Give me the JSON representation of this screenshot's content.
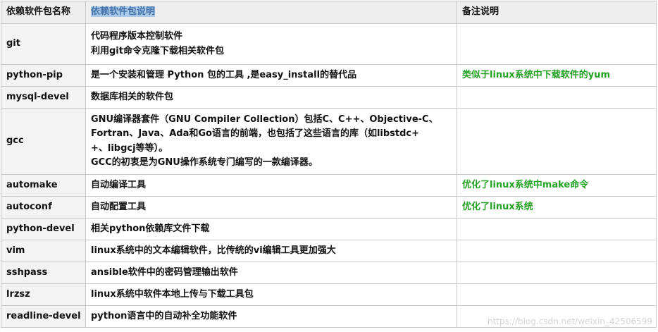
{
  "table": {
    "headers": [
      "依赖软件包名称",
      "依赖软件包说明",
      "备注说明"
    ],
    "rows": [
      {
        "name": "git",
        "desc": [
          "代码程序版本控制软件",
          "利用git命令克隆下载相关软件包"
        ],
        "note": ""
      },
      {
        "name": "python-pip",
        "desc": [
          "是一个安装和管理 Python 包的工具 ,是easy_install的替代品"
        ],
        "note": "类似于linux系统中下载软件的yum"
      },
      {
        "name": "mysql-devel",
        "desc": [
          "数据库相关的软件包"
        ],
        "note": ""
      },
      {
        "name": "gcc",
        "desc": [
          "GNU编译器套件（GNU Compiler Collection）包括C、C++、Objective-C、",
          "Fortran、Java、Ada和Go语言的前端，也包括了这些语言的库（如libstdc+",
          "+、libgcj等等）。",
          "GCC的初衷是为GNU操作系统专门编写的一款编译器。"
        ],
        "note": ""
      },
      {
        "name": "automake",
        "desc": [
          "自动编译工具"
        ],
        "note": "优化了linux系统中make命令"
      },
      {
        "name": "autoconf",
        "desc": [
          "自动配置工具"
        ],
        "note": "优化了linux系统"
      },
      {
        "name": "python-devel",
        "desc": [
          "相关python依赖库文件下载"
        ],
        "note": ""
      },
      {
        "name": "vim",
        "desc": [
          "linux系统中的文本编辑软件，比传统的vi编辑工具更加强大"
        ],
        "note": ""
      },
      {
        "name": "sshpass",
        "desc": [
          "ansible软件中的密码管理输出软件"
        ],
        "note": ""
      },
      {
        "name": "lrzsz",
        "desc": [
          "linux系统中软件本地上传与下载工具包"
        ],
        "note": ""
      },
      {
        "name": "readline-devel",
        "desc": [
          "python语言中的自动补全功能软件"
        ],
        "note": ""
      }
    ]
  },
  "watermark": "https://blog.csdn.net/weixin_42506599",
  "colors": {
    "header_bg": "#eeeeee",
    "header_highlight": "#a9cbe9",
    "note_text": "#23a123",
    "border": "#c8c8c8"
  }
}
